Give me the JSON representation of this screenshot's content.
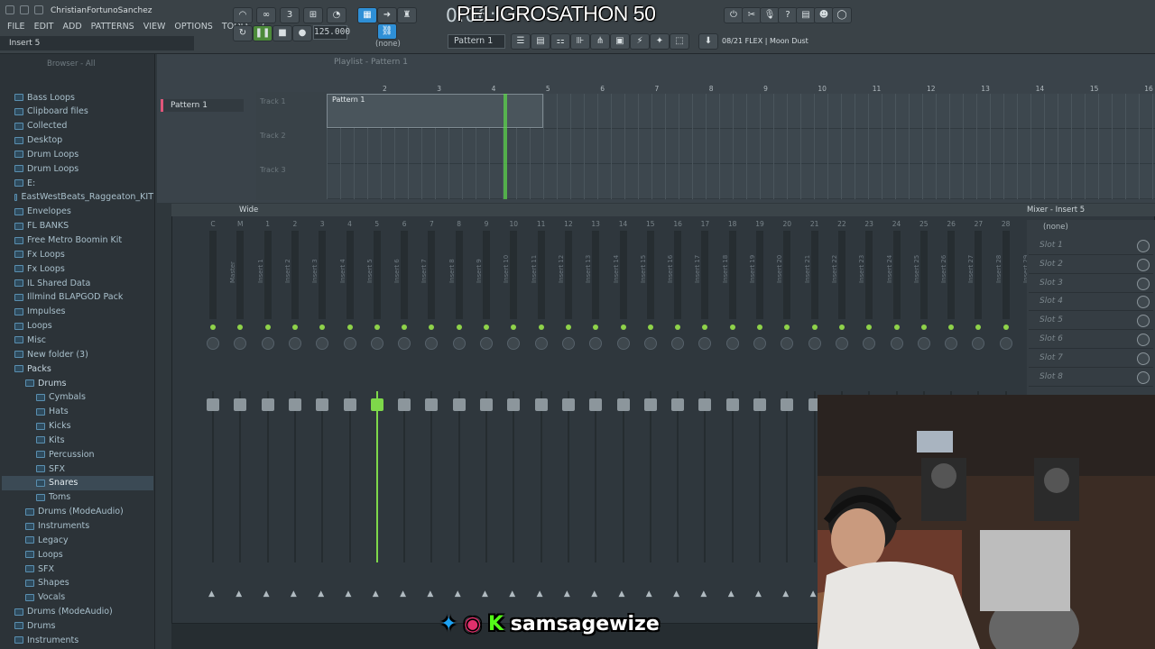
{
  "window": {
    "title": "ChristianFortunoSanchez"
  },
  "menu": [
    "FILE",
    "EDIT",
    "ADD",
    "PATTERNS",
    "VIEW",
    "OPTIONS",
    "TOOLS",
    "?"
  ],
  "hint": "Insert 5",
  "transport": {
    "tempo": "125.000",
    "time": "0:06:",
    "pattern": "Pattern 1",
    "snap": "(none)"
  },
  "overlay": {
    "stream_title": "PELIGROSATHON 50",
    "social_handle": "samsagewize"
  },
  "news": "08/21 FLEX | Moon Dust",
  "browser": {
    "title": "Browser - All",
    "items": [
      {
        "label": "Bass Loops",
        "depth": 0
      },
      {
        "label": "Clipboard files",
        "depth": 0
      },
      {
        "label": "Collected",
        "depth": 0
      },
      {
        "label": "Desktop",
        "depth": 0
      },
      {
        "label": "Drum Loops",
        "depth": 0
      },
      {
        "label": "Drum Loops",
        "depth": 0
      },
      {
        "label": "E:",
        "depth": 0
      },
      {
        "label": "EastWestBeats_Raggeaton_KIT",
        "depth": 0
      },
      {
        "label": "Envelopes",
        "depth": 0
      },
      {
        "label": "FL BANKS",
        "depth": 0
      },
      {
        "label": "Free Metro Boomin Kit",
        "depth": 0
      },
      {
        "label": "Fx Loops",
        "depth": 0
      },
      {
        "label": "Fx Loops",
        "depth": 0
      },
      {
        "label": "IL Shared Data",
        "depth": 0
      },
      {
        "label": "Illmind BLAPGOD Pack",
        "depth": 0
      },
      {
        "label": "Impulses",
        "depth": 0
      },
      {
        "label": "Loops",
        "depth": 0
      },
      {
        "label": "Misc",
        "depth": 0
      },
      {
        "label": "New folder (3)",
        "depth": 0
      },
      {
        "label": "Packs",
        "depth": 0,
        "open": true
      },
      {
        "label": "Drums",
        "depth": 1,
        "open": true
      },
      {
        "label": "Cymbals",
        "depth": 2
      },
      {
        "label": "Hats",
        "depth": 2
      },
      {
        "label": "Kicks",
        "depth": 2
      },
      {
        "label": "Kits",
        "depth": 2
      },
      {
        "label": "Percussion",
        "depth": 2
      },
      {
        "label": "SFX",
        "depth": 2
      },
      {
        "label": "Snares",
        "depth": 2,
        "selected": true
      },
      {
        "label": "Toms",
        "depth": 2
      },
      {
        "label": "Drums (ModeAudio)",
        "depth": 1
      },
      {
        "label": "Instruments",
        "depth": 1
      },
      {
        "label": "Legacy",
        "depth": 1
      },
      {
        "label": "Loops",
        "depth": 1
      },
      {
        "label": "SFX",
        "depth": 1
      },
      {
        "label": "Shapes",
        "depth": 1
      },
      {
        "label": "Vocals",
        "depth": 1
      },
      {
        "label": "Drums (ModeAudio)",
        "depth": 0
      },
      {
        "label": "Drums",
        "depth": 0
      },
      {
        "label": "Instruments",
        "depth": 0
      }
    ]
  },
  "playlist": {
    "title": "Playlist - Pattern 1",
    "pattern_list": "Pattern 1",
    "tracks": [
      "Track 1",
      "Track 2",
      "Track 3"
    ],
    "clip": "Pattern 1",
    "ruler": [
      "2",
      "3",
      "4",
      "5",
      "6",
      "7",
      "8",
      "9",
      "10",
      "11",
      "12",
      "13",
      "14",
      "15",
      "16"
    ]
  },
  "mixer": {
    "mode": "Wide",
    "title": "Mixer - Insert 5",
    "selected_insert": "5",
    "strips": [
      "C",
      "M",
      "1",
      "2",
      "3",
      "4",
      "5",
      "6",
      "7",
      "8",
      "9",
      "10",
      "11",
      "12",
      "13",
      "14",
      "15",
      "16",
      "17",
      "18",
      "19",
      "20",
      "21",
      "22",
      "23",
      "24",
      "25",
      "26",
      "27",
      "28",
      "29"
    ],
    "strip_names": [
      "Master",
      "Insert 1",
      "Insert 2",
      "Insert 3",
      "Insert 4",
      "Insert 5",
      "Insert 6",
      "Insert 7",
      "Insert 8",
      "Insert 9",
      "Insert 10",
      "Insert 11",
      "Insert 12",
      "Insert 13",
      "Insert 14",
      "Insert 15",
      "Insert 16",
      "Insert 17",
      "Insert 18",
      "Insert 19",
      "Insert 20",
      "Insert 21",
      "Insert 22",
      "Insert 23",
      "Insert 24",
      "Insert 25",
      "Insert 26",
      "Insert 27",
      "Insert 28",
      "Insert 29"
    ],
    "slots_header": "(none)",
    "slots": [
      "Slot 1",
      "Slot 2",
      "Slot 3",
      "Slot 4",
      "Slot 5",
      "Slot 6",
      "Slot 7",
      "Slot 8"
    ]
  },
  "colors": {
    "accent": "#2e8fd6",
    "meter": "#7ed84a",
    "pattern": "#e0567a"
  }
}
